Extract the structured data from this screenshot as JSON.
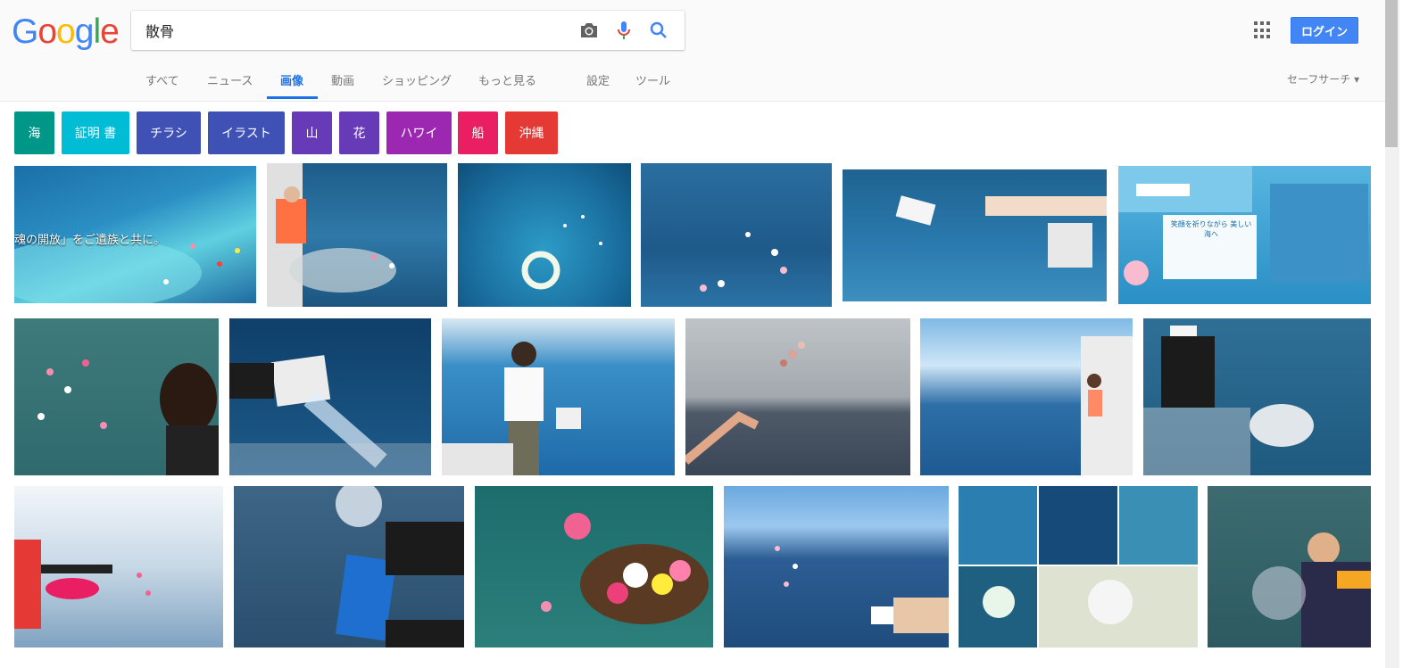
{
  "logo": {
    "letters": [
      "G",
      "o",
      "o",
      "g",
      "l",
      "e"
    ]
  },
  "search": {
    "query": "散骨"
  },
  "header": {
    "login_label": "ログイン"
  },
  "tabs": [
    {
      "label": "すべて"
    },
    {
      "label": "ニュース"
    },
    {
      "label": "画像"
    },
    {
      "label": "動画"
    },
    {
      "label": "ショッピング"
    },
    {
      "label": "もっと見る"
    },
    {
      "label": "設定"
    },
    {
      "label": "ツール"
    }
  ],
  "safesearch": {
    "label": "セーフサーチ ▾"
  },
  "chips": [
    {
      "label": "海",
      "color": "#009688"
    },
    {
      "label": "証明 書",
      "color": "#00bcd4"
    },
    {
      "label": "チラシ",
      "color": "#3f51b5"
    },
    {
      "label": "イラスト",
      "color": "#3f51b5"
    },
    {
      "label": "山",
      "color": "#673ab7"
    },
    {
      "label": "花",
      "color": "#673ab7"
    },
    {
      "label": "ハワイ",
      "color": "#9c27b0"
    },
    {
      "label": "船",
      "color": "#e91e63"
    },
    {
      "label": "沖縄",
      "color": "#e53935"
    }
  ],
  "results": {
    "row1_overlay_text": "魂の開放」をご遺族と共に。",
    "row1_poster_text": "笑顔を祈りながら 美しい海へ"
  },
  "colors": {
    "accent": "#1a73e8",
    "login_bg": "#4285f4"
  }
}
